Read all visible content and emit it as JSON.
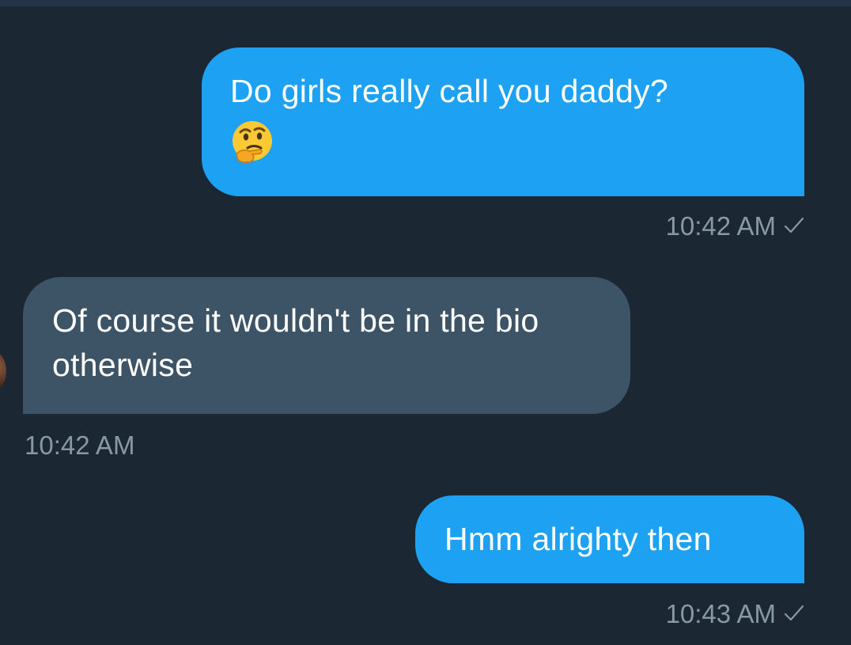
{
  "conversation": {
    "messages": [
      {
        "direction": "sent",
        "text": "Do girls really call you daddy?",
        "emoji": "thinking-face-emoji",
        "time": "10:42 AM",
        "status_icon": "checkmark-icon"
      },
      {
        "direction": "received",
        "text": "Of course it wouldn't be in the bio otherwise",
        "time": "10:42 AM"
      },
      {
        "direction": "sent",
        "text": "Hmm alrighty then",
        "time": "10:43 AM",
        "status_icon": "checkmark-icon"
      }
    ]
  },
  "colors": {
    "background": "#1b2733",
    "sent_bubble": "#1da1f2",
    "received_bubble": "#3d5466",
    "timestamp": "#8899a6"
  }
}
